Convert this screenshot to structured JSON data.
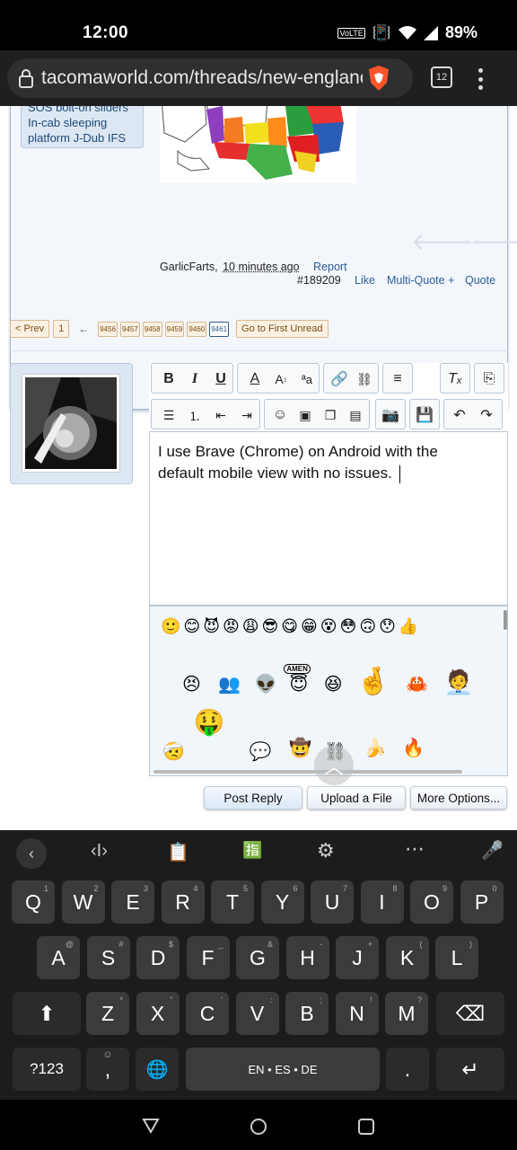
{
  "status": {
    "time": "12:00",
    "battery": "89%",
    "network": "VoLTE"
  },
  "browser": {
    "url": "tacomaworld.com/threads/new-englanc",
    "tab_count": "12"
  },
  "post": {
    "signature": [
      "SOS bolt-on sliders",
      "In-cab sleeping",
      "platform J-Dub IFS"
    ],
    "author": "GarlicFarts,",
    "time": "10 minutes ago",
    "report": "Report",
    "number": "#189209",
    "like": "Like",
    "multiquote": "Multi-Quote +",
    "quote": "Quote"
  },
  "pagination": {
    "prev": "< Prev",
    "first": "1",
    "ellipsis": "←",
    "pages": [
      "9456",
      "9457",
      "9458",
      "9459",
      "9460",
      "9461"
    ],
    "current": "9461",
    "first_unread": "Go to First Unread"
  },
  "editor": {
    "text_line1": "I use Brave (Chrome) on Android with the",
    "text_line2": "default mobile view with no issues.",
    "smilie_labels": {
      "amen": "AMEN"
    }
  },
  "actions": {
    "post_reply": "Post Reply",
    "upload": "Upload a File",
    "more": "More Options..."
  },
  "keyboard": {
    "row1": [
      [
        "Q",
        "1"
      ],
      [
        "W",
        "2"
      ],
      [
        "E",
        "3"
      ],
      [
        "R",
        "4"
      ],
      [
        "T",
        "5"
      ],
      [
        "Y",
        "6"
      ],
      [
        "U",
        "7"
      ],
      [
        "I",
        "8"
      ],
      [
        "O",
        "9"
      ],
      [
        "P",
        "0"
      ]
    ],
    "row2": [
      [
        "A",
        "@"
      ],
      [
        "S",
        "#"
      ],
      [
        "D",
        "$"
      ],
      [
        "F",
        "_"
      ],
      [
        "G",
        "&"
      ],
      [
        "H",
        "-"
      ],
      [
        "J",
        "+"
      ],
      [
        "K",
        "("
      ],
      [
        "L",
        ")"
      ]
    ],
    "row3": [
      [
        "Z",
        "*"
      ],
      [
        "X",
        "\""
      ],
      [
        "C",
        "'"
      ],
      [
        "V",
        ":"
      ],
      [
        "B",
        ";"
      ],
      [
        "N",
        "!"
      ],
      [
        "M",
        "?"
      ]
    ],
    "sym": "?123",
    "comma": ",",
    "space": "EN • ES • DE",
    "period": "."
  },
  "colors": {
    "brave": "#fb542b",
    "link": "#2a5d9a",
    "accent": "#2f5a8c"
  }
}
